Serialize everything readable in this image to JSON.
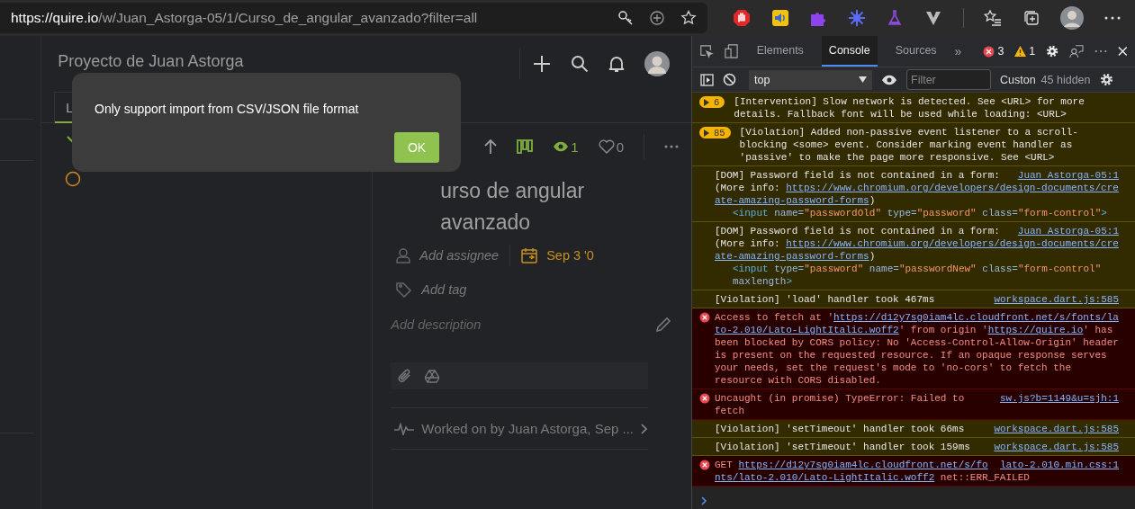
{
  "browser": {
    "url_origin": "https://quire.io",
    "url_path": "/w/Juan_Astorga-05/1/Curso_de_angular_avanzado?filter=all"
  },
  "app": {
    "project_title": "Proyecto de Juan Astorga",
    "tabs": [
      {
        "label": "L",
        "selected": true
      }
    ],
    "dialog": {
      "message": "Only support import from CSV/JSON file format",
      "button": "OK"
    },
    "task": {
      "watchers": "1",
      "likes": "0",
      "title_lines": [
        "urso de angular",
        "avanzado"
      ],
      "assignee_placeholder": "Add assignee",
      "due": "Sep 3 '0",
      "tag_placeholder": "Add tag",
      "description_placeholder": "Add description",
      "activity": "Worked on by Juan Astorga, Sep ..."
    }
  },
  "devtools": {
    "tabs": [
      {
        "label": "Elements",
        "selected": false
      },
      {
        "label": "Console",
        "selected": true
      },
      {
        "label": "Sources",
        "selected": false
      }
    ],
    "more": "»",
    "errors": "3",
    "warnings": "1",
    "context": "top",
    "filter_placeholder": "Filter",
    "levels": "Custon",
    "hidden": "45 hidden",
    "messages": [
      {
        "kind": "warning",
        "count": "6",
        "lines": [
          {
            "kind": "text",
            "parts": [
              {
                "kind": "text",
                "t": "[Intervention] Slow network is detected. See <URL> for more"
              }
            ]
          },
          {
            "kind": "text",
            "parts": [
              {
                "kind": "text",
                "t": "details. Fallback font will be used while loading: <URL>"
              }
            ]
          }
        ]
      },
      {
        "kind": "warning",
        "count": "85",
        "lines": [
          {
            "kind": "text",
            "parts": [
              {
                "kind": "text",
                "t": "[Violation] Added non-passive event listener to a scroll-"
              }
            ]
          },
          {
            "kind": "text",
            "parts": [
              {
                "kind": "text",
                "t": "blocking <some> event. Consider marking event handler as"
              }
            ]
          },
          {
            "kind": "text",
            "parts": [
              {
                "kind": "text",
                "t": "'passive' to make the page more responsive. See <URL>"
              }
            ]
          }
        ]
      },
      {
        "kind": "verbose",
        "source": "Juan Astorga-05:1",
        "lines": [
          {
            "kind": "text",
            "parts": [
              {
                "kind": "text",
                "t": "[DOM] Password field is not contained in a form:"
              }
            ]
          },
          {
            "kind": "text",
            "parts": [
              {
                "kind": "text",
                "t": "(More info: "
              },
              {
                "kind": "link",
                "t": "https://www.chromium.org/developers/design-documents/cre"
              }
            ]
          },
          {
            "kind": "text",
            "parts": [
              {
                "kind": "link",
                "t": "ate-amazing-password-forms"
              },
              {
                "kind": "text",
                "t": ")"
              }
            ]
          },
          {
            "kind": "code",
            "parts": [
              {
                "kind": "tag",
                "t": "<input "
              },
              {
                "kind": "attr",
                "t": "name="
              },
              {
                "kind": "value",
                "t": "\"passwordOld\" "
              },
              {
                "kind": "attr",
                "t": "type="
              },
              {
                "kind": "value",
                "t": "\"password\" "
              },
              {
                "kind": "attr",
                "t": "class="
              },
              {
                "kind": "value",
                "t": "\"form-control\""
              },
              {
                "kind": "tag",
                "t": ">"
              }
            ]
          }
        ]
      },
      {
        "kind": "verbose",
        "source": "Juan Astorga-05:1",
        "lines": [
          {
            "kind": "text",
            "parts": [
              {
                "kind": "text",
                "t": "[DOM] Password field is not contained in a form:"
              }
            ]
          },
          {
            "kind": "text",
            "parts": [
              {
                "kind": "text",
                "t": "(More info: "
              },
              {
                "kind": "link",
                "t": "https://www.chromium.org/developers/design-documents/cre"
              }
            ]
          },
          {
            "kind": "text",
            "parts": [
              {
                "kind": "link",
                "t": "ate-amazing-password-forms"
              },
              {
                "kind": "text",
                "t": ")"
              }
            ]
          },
          {
            "kind": "code",
            "parts": [
              {
                "kind": "tag",
                "t": "<input "
              },
              {
                "kind": "attr",
                "t": "type="
              },
              {
                "kind": "value",
                "t": "\"password\" "
              },
              {
                "kind": "attr",
                "t": "name="
              },
              {
                "kind": "value",
                "t": "\"passwordNew\" "
              },
              {
                "kind": "attr",
                "t": "class="
              },
              {
                "kind": "value",
                "t": "\"form-control\""
              }
            ]
          },
          {
            "kind": "code",
            "parts": [
              {
                "kind": "attr",
                "t": "maxlength"
              },
              {
                "kind": "tag",
                "t": ">"
              }
            ]
          }
        ]
      },
      {
        "kind": "verbose",
        "source": "workspace.dart.js:585",
        "lines": [
          {
            "kind": "text",
            "parts": [
              {
                "kind": "text",
                "t": "[Violation] 'load' handler took 467ms"
              }
            ]
          }
        ]
      },
      {
        "kind": "error",
        "lines": [
          {
            "kind": "text",
            "parts": [
              {
                "kind": "text",
                "t": "Access to fetch at '"
              },
              {
                "kind": "link",
                "t": "https://d12y7sg0iam4lc.cloudfront.net/s/fonts/la"
              }
            ]
          },
          {
            "kind": "text",
            "parts": [
              {
                "kind": "link",
                "t": "to-2.010/Lato-LightItalic.woff2"
              },
              {
                "kind": "text",
                "t": "' from origin '"
              },
              {
                "kind": "link",
                "t": "https://quire.io"
              },
              {
                "kind": "text",
                "t": "' has"
              }
            ]
          },
          {
            "kind": "text",
            "parts": [
              {
                "kind": "text",
                "t": "been blocked by CORS policy: No 'Access-Control-Allow-Origin' header"
              }
            ]
          },
          {
            "kind": "text",
            "parts": [
              {
                "kind": "text",
                "t": "is present on the requested resource. If an opaque response serves"
              }
            ]
          },
          {
            "kind": "text",
            "parts": [
              {
                "kind": "text",
                "t": "your needs, set the request's mode to 'no-cors' to fetch the"
              }
            ]
          },
          {
            "kind": "text",
            "parts": [
              {
                "kind": "text",
                "t": "resource with CORS disabled."
              }
            ]
          }
        ]
      },
      {
        "kind": "error",
        "source": "sw.js?b=1149&u=sjh:1",
        "lines": [
          {
            "kind": "text",
            "parts": [
              {
                "kind": "text",
                "t": "Uncaught (in promise) TypeError: Failed to"
              }
            ]
          },
          {
            "kind": "text",
            "parts": [
              {
                "kind": "text",
                "t": "fetch"
              }
            ]
          }
        ]
      },
      {
        "kind": "verbose",
        "source": "workspace.dart.js:585",
        "lines": [
          {
            "kind": "text",
            "parts": [
              {
                "kind": "text",
                "t": "[Violation] 'setTimeout' handler took 66ms"
              }
            ]
          }
        ]
      },
      {
        "kind": "verbose",
        "source": "workspace.dart.js:585",
        "lines": [
          {
            "kind": "text",
            "parts": [
              {
                "kind": "text",
                "t": "[Violation] 'setTimeout' handler took 159ms"
              }
            ]
          }
        ]
      },
      {
        "kind": "error",
        "source": "lato-2.010.min.css:1",
        "lines": [
          {
            "kind": "text",
            "parts": [
              {
                "kind": "text",
                "t": "GET "
              },
              {
                "kind": "link",
                "t": "https://d12y7sg0iam4lc.cloudfront.net/s/fo"
              }
            ]
          },
          {
            "kind": "text",
            "parts": [
              {
                "kind": "link",
                "t": "nts/lato-2.010/Lato-LightItalic.woff2"
              },
              {
                "kind": "text",
                "t": " net::ERR_FAILED"
              }
            ]
          }
        ]
      }
    ]
  }
}
